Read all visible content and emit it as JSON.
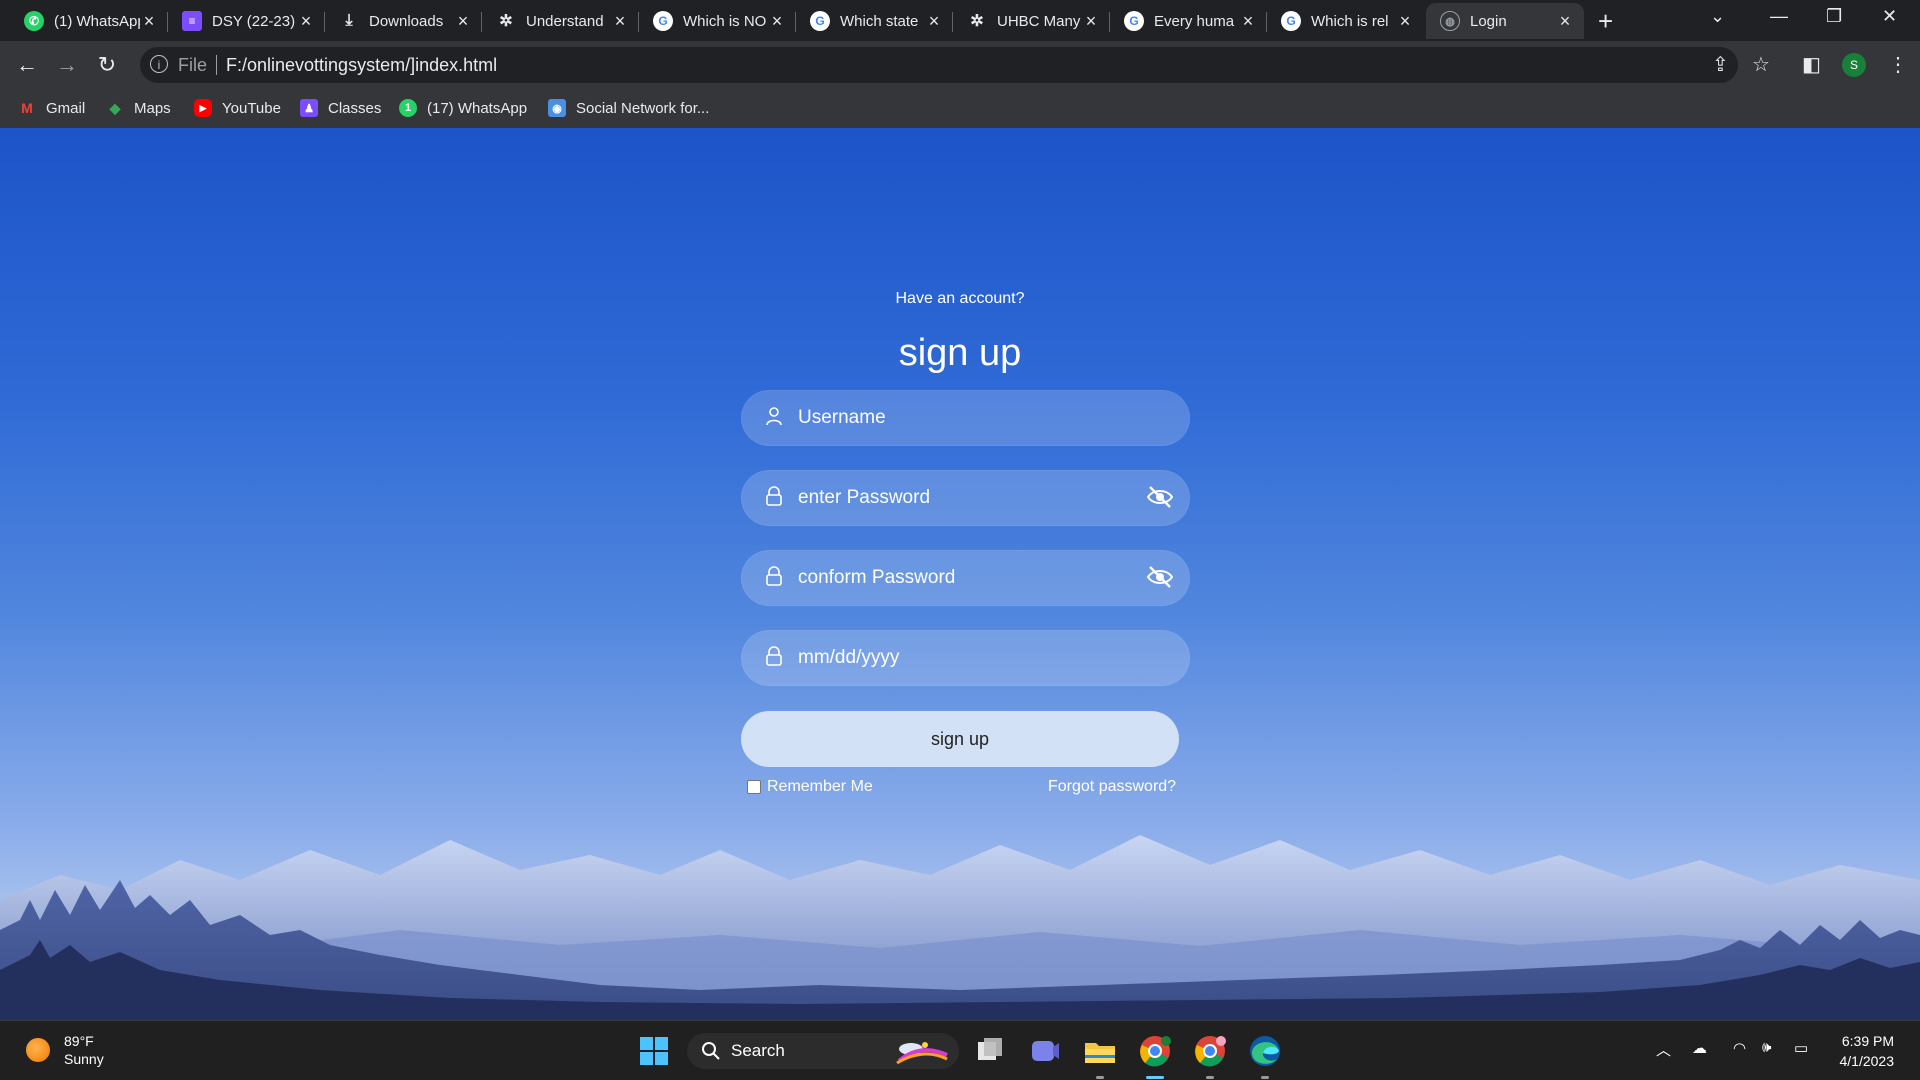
{
  "browser": {
    "tabs": [
      {
        "title": "(1) WhatsApp",
        "icon": "whatsapp-icon",
        "color": "#25d366"
      },
      {
        "title": "DSY (22-23)",
        "icon": "list-icon",
        "color": "#7c4dff"
      },
      {
        "title": "Downloads",
        "icon": "download-icon",
        "color": "#e8eaed"
      },
      {
        "title": "Understand",
        "icon": "openai-icon",
        "color": "#e8eaed"
      },
      {
        "title": "Which is NO",
        "icon": "google-icon",
        "color": "#4285f4"
      },
      {
        "title": "Which state",
        "icon": "google-icon",
        "color": "#4285f4"
      },
      {
        "title": "UHBC Many",
        "icon": "openai-icon",
        "color": "#e8eaed"
      },
      {
        "title": "Every huma",
        "icon": "google-icon",
        "color": "#4285f4"
      },
      {
        "title": "Which is rel",
        "icon": "google-icon",
        "color": "#4285f4"
      },
      {
        "title": "Login",
        "icon": "globe-icon",
        "color": "#9aa0a6",
        "active": true
      }
    ],
    "new_tab": "+",
    "address": {
      "scheme": "File",
      "url": "F:/onlinevottingsystem/]index.html"
    },
    "profile_initial": "S",
    "bookmarks": [
      {
        "label": "Gmail",
        "icon": "gmail-icon",
        "color": "#ea4335",
        "glyph": "M"
      },
      {
        "label": "Maps",
        "icon": "maps-icon",
        "color": "#34a853",
        "glyph": "◆"
      },
      {
        "label": "YouTube",
        "icon": "youtube-icon",
        "color": "#ff0000",
        "glyph": "▶"
      },
      {
        "label": "Classes",
        "icon": "classes-icon",
        "color": "#7c4dff",
        "glyph": "♟"
      },
      {
        "label": "(17) WhatsApp",
        "icon": "whatsapp-icon",
        "color": "#25d366",
        "glyph": "1"
      },
      {
        "label": "Social Network for...",
        "icon": "social-network-icon",
        "color": "#4a90e2",
        "glyph": "◉"
      }
    ]
  },
  "form": {
    "subtitle": "Have an account?",
    "title": "sign up",
    "username_placeholder": "Username",
    "password_placeholder": "enter Password",
    "confirm_placeholder": "conform Password",
    "date_placeholder": "mm/dd/yyyy",
    "submit_label": "sign up",
    "remember_label": "Remember Me",
    "forgot_label": "Forgot password?"
  },
  "taskbar": {
    "weather_temp": "89°F",
    "weather_desc": "Sunny",
    "search_label": "Search",
    "time": "6:39 PM",
    "date": "4/1/2023"
  },
  "colors": {
    "page_gradient_top": "#1d54c8",
    "field_bg": "rgba(255,255,255,0.18)",
    "button_bg": "#d3e1f7",
    "chrome_dark": "#202124",
    "chrome_toolbar": "#35363a"
  }
}
